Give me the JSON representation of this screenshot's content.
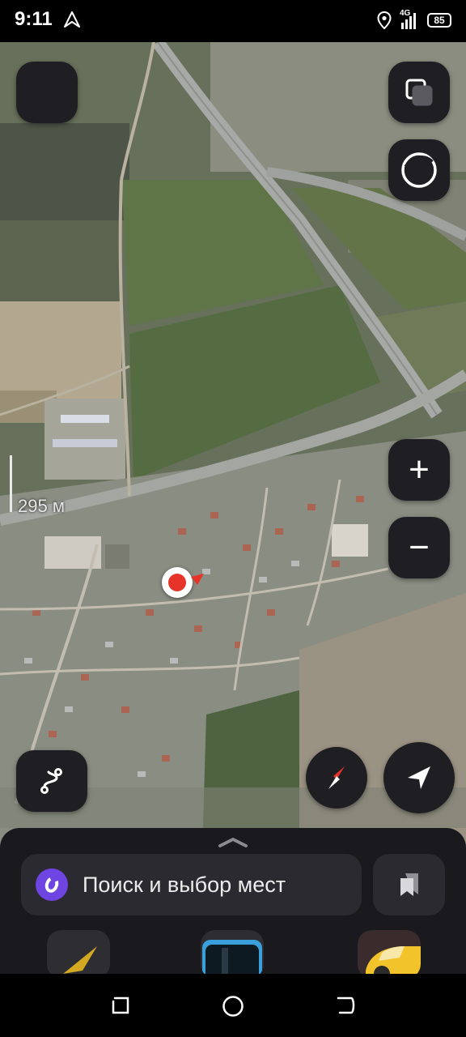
{
  "status": {
    "time": "9:11",
    "network": "4G",
    "battery": "85",
    "icons": [
      "navigation-arrow-icon",
      "location-icon",
      "signal-icon",
      "battery-icon"
    ]
  },
  "map": {
    "scale_label": "295 м",
    "controls": {
      "menu": "menu-button",
      "layers": "layers-icon",
      "profile": "profile-icon",
      "zoom_in": "+",
      "zoom_out": "−",
      "routes": "route-icon",
      "compass": "compass-icon",
      "my_location": "navigation-arrow-icon"
    }
  },
  "sheet": {
    "search_placeholder": "Поиск и выбор мест",
    "assistant_icon": "alice-icon",
    "bookmarks_icon": "bookmarks-icon",
    "shortcuts": [
      "navigator-icon",
      "transit-icon",
      "taxi-icon"
    ]
  },
  "navbar": {
    "icons": [
      "recents-icon",
      "home-icon",
      "back-icon"
    ]
  },
  "colors": {
    "panel": "#1f1f23",
    "sheet": "#1a1a1e",
    "search": "#2a2a30",
    "alice": "#6e45e2",
    "marker": "#e6342a"
  }
}
